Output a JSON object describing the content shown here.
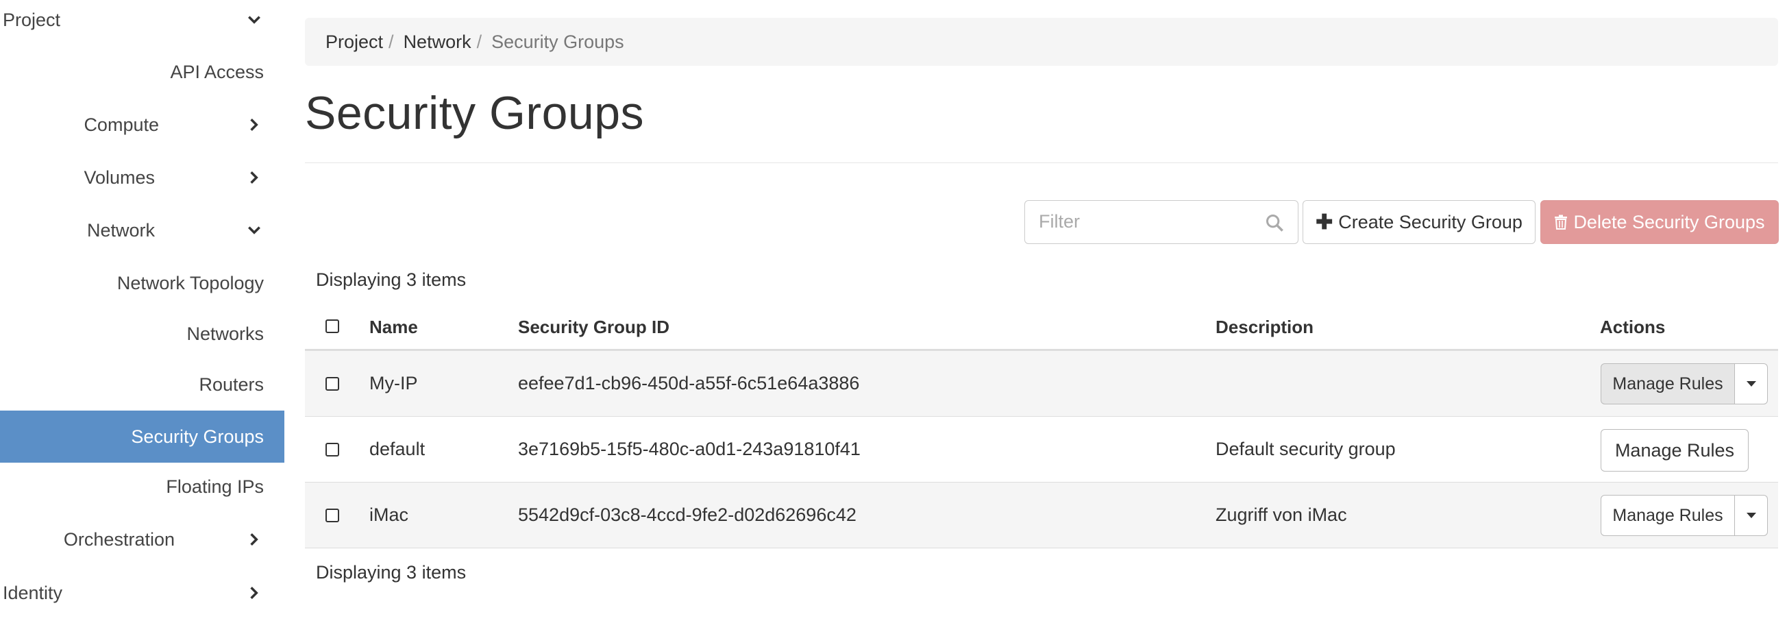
{
  "sidebar": {
    "project_label": "Project",
    "items": [
      {
        "label": "API Access"
      },
      {
        "label": "Compute"
      },
      {
        "label": "Volumes"
      },
      {
        "label": "Network"
      },
      {
        "label": "Network Topology"
      },
      {
        "label": "Networks"
      },
      {
        "label": "Routers"
      },
      {
        "label": "Security Groups"
      },
      {
        "label": "Floating IPs"
      },
      {
        "label": "Orchestration"
      }
    ],
    "identity_label": "Identity",
    "active_color": "#5b8fc7"
  },
  "breadcrumb": [
    "Project",
    "Network",
    "Security Groups"
  ],
  "page_title": "Security Groups",
  "toolbar": {
    "filter_placeholder": "Filter",
    "create_label": "Create Security Group",
    "delete_label": "Delete Security Groups",
    "delete_color": "#e29a9a"
  },
  "table": {
    "count_text": "Displaying 3 items",
    "headers": [
      "Name",
      "Security Group ID",
      "Description",
      "Actions"
    ],
    "rows": [
      {
        "name": "My-IP",
        "id": "eefee7d1-cb96-450d-a55f-6c51e64a3886",
        "description": "",
        "action": "Manage Rules"
      },
      {
        "name": "default",
        "id": "3e7169b5-15f5-480c-a0d1-243a91810f41",
        "description": "Default security group",
        "action": "Manage Rules"
      },
      {
        "name": "iMac",
        "id": "5542d9cf-03c8-4ccd-9fe2-d02d62696c42",
        "description": "Zugriff von iMac",
        "action": "Manage Rules"
      }
    ]
  }
}
